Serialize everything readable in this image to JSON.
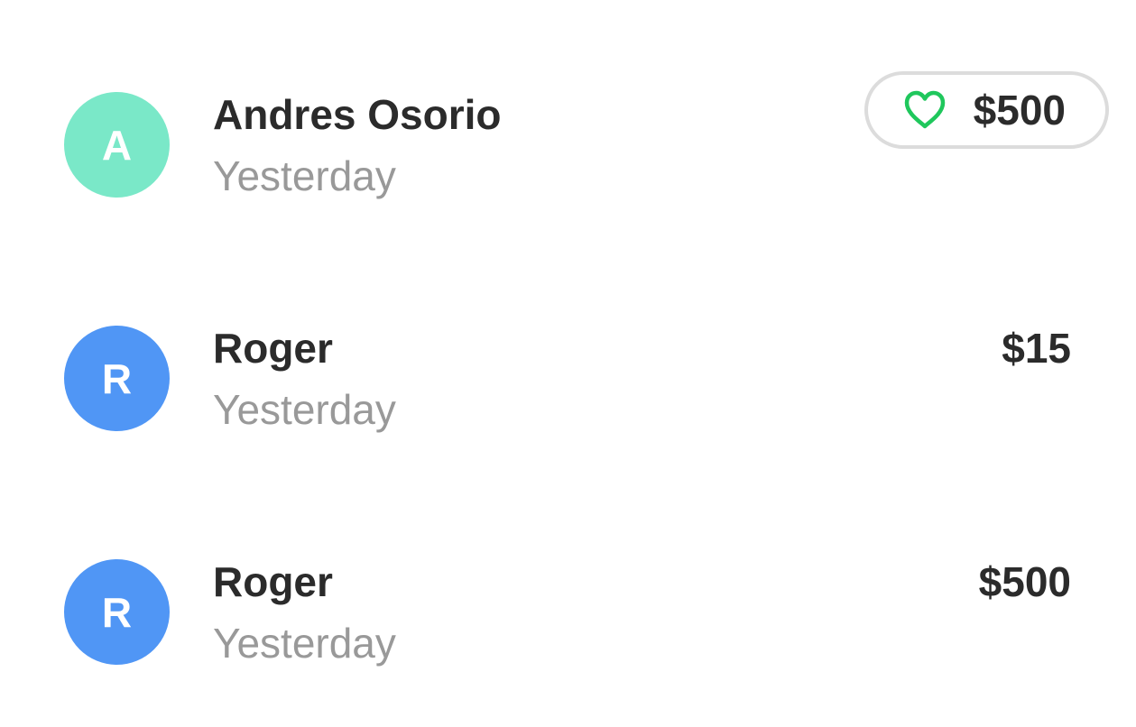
{
  "activity": {
    "items": [
      {
        "initial": "A",
        "name": "Andres Osorio",
        "time": "Yesterday",
        "amount": "$500",
        "avatar_color": "#7ae8c8",
        "liked": true,
        "icon": "heart-outline-icon"
      },
      {
        "initial": "R",
        "name": "Roger",
        "time": "Yesterday",
        "amount": "$15",
        "avatar_color": "#5096f5",
        "liked": false
      },
      {
        "initial": "R",
        "name": "Roger",
        "time": "Yesterday",
        "amount": "$500",
        "avatar_color": "#5096f5",
        "liked": false
      }
    ]
  },
  "colors": {
    "name_text": "#2b2b2b",
    "secondary_text": "#999999",
    "pill_border": "#dcdcdc",
    "heart": "#1fc75c"
  }
}
